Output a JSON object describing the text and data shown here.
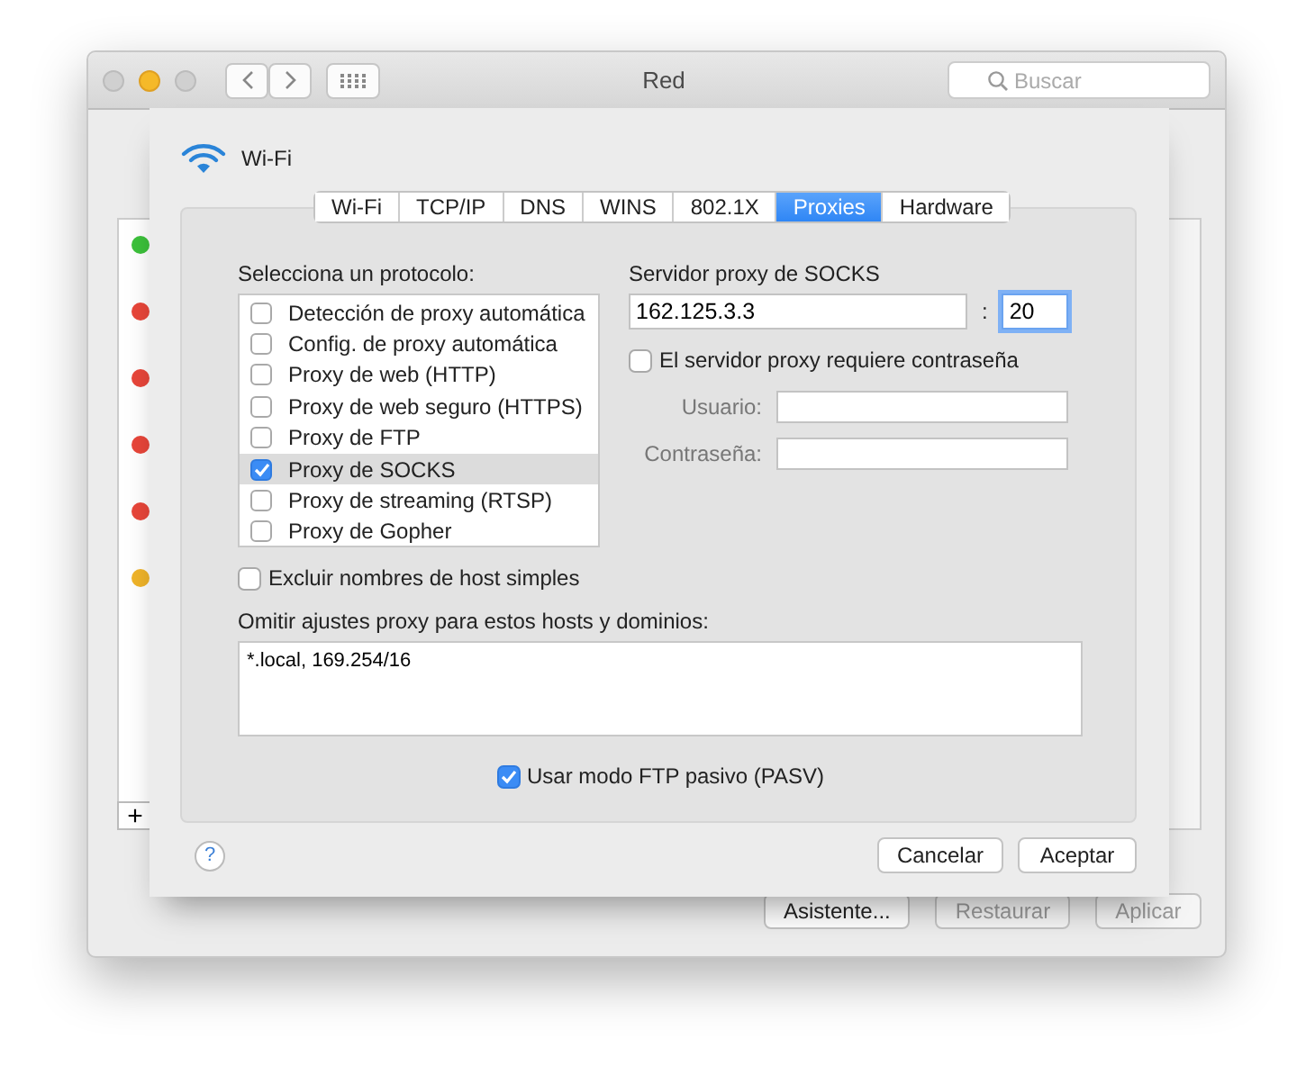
{
  "window": {
    "title": "Red",
    "search": {
      "placeholder": "Buscar"
    }
  },
  "services": [
    {
      "color": "#3cc13b"
    },
    {
      "color": "#e8463a"
    },
    {
      "color": "#e8463a"
    },
    {
      "color": "#e8463a"
    },
    {
      "color": "#e8463a"
    },
    {
      "color": "#f0b429"
    }
  ],
  "add_button": "+",
  "sheet": {
    "interface": "Wi-Fi",
    "tabs": [
      {
        "label": "Wi-Fi",
        "selected": false
      },
      {
        "label": "TCP/IP",
        "selected": false
      },
      {
        "label": "DNS",
        "selected": false
      },
      {
        "label": "WINS",
        "selected": false
      },
      {
        "label": "802.1X",
        "selected": false
      },
      {
        "label": "Proxies",
        "selected": true
      },
      {
        "label": "Hardware",
        "selected": false
      }
    ],
    "protocol_label": "Selecciona un protocolo:",
    "protocols": [
      {
        "label": "Detección de proxy automática",
        "checked": false,
        "selected": false
      },
      {
        "label": "Config. de proxy automática",
        "checked": false,
        "selected": false
      },
      {
        "label": "Proxy de web (HTTP)",
        "checked": false,
        "selected": false
      },
      {
        "label": "Proxy de web seguro (HTTPS)",
        "checked": false,
        "selected": false
      },
      {
        "label": "Proxy de FTP",
        "checked": false,
        "selected": false
      },
      {
        "label": "Proxy de SOCKS",
        "checked": true,
        "selected": true
      },
      {
        "label": "Proxy de streaming (RTSP)",
        "checked": false,
        "selected": false
      },
      {
        "label": "Proxy de Gopher",
        "checked": false,
        "selected": false
      }
    ],
    "server_label": "Servidor proxy de SOCKS",
    "server": "162.125.3.3",
    "separator": ":",
    "port": "20",
    "password_required": {
      "label": "El servidor proxy requiere contraseña",
      "checked": false
    },
    "user_label": "Usuario:",
    "password_label": "Contraseña:",
    "exclude_simple": {
      "label": "Excluir nombres de host simples",
      "checked": false
    },
    "bypass_label": "Omitir ajustes proxy para estos hosts y dominios:",
    "bypass": "*.local, 169.254/16",
    "passive_ftp": {
      "label": "Usar modo FTP pasivo (PASV)",
      "checked": true
    },
    "help": "?",
    "buttons": [
      "Cancelar",
      "Aceptar"
    ]
  },
  "window_buttons": [
    {
      "label": "Asistente...",
      "disabled": false
    },
    {
      "label": "Restaurar",
      "disabled": true
    },
    {
      "label": "Aplicar",
      "disabled": true
    }
  ]
}
